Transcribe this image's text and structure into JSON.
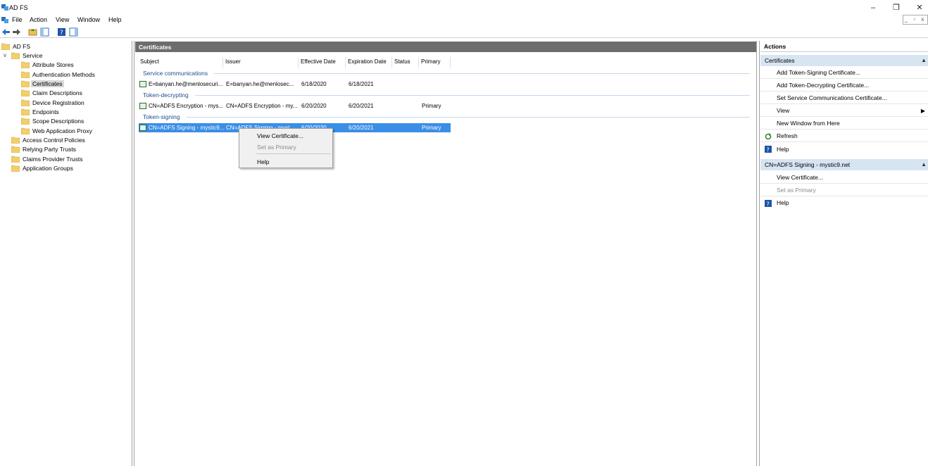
{
  "window": {
    "title": "AD FS",
    "minimize": "–",
    "restore": "❐",
    "close": "✕"
  },
  "menu": [
    "File",
    "Action",
    "View",
    "Window",
    "Help"
  ],
  "mdi_controls": "_ ▫ x",
  "tree": {
    "root": "AD FS",
    "service": "Service",
    "service_children": [
      "Attribute Stores",
      "Authentication Methods",
      "Certificates",
      "Claim Descriptions",
      "Device Registration",
      "Endpoints",
      "Scope Descriptions",
      "Web Application Proxy"
    ],
    "top_level": [
      "Access Control Policies",
      "Relying Party Trusts",
      "Claims Provider Trusts",
      "Application Groups"
    ]
  },
  "center": {
    "title": "Certificates",
    "columns": [
      "Subject",
      "Issuer",
      "Effective Date",
      "Expiration Date",
      "Status",
      "Primary"
    ],
    "groups": [
      {
        "name": "Service communications",
        "rows": [
          {
            "subject": "E=banyan.he@menlosecuri...",
            "issuer": "E=banyan.he@menlosec...",
            "effective": "6/18/2020",
            "expiration": "6/18/2021",
            "status": "",
            "primary": ""
          }
        ]
      },
      {
        "name": "Token-decrypting",
        "rows": [
          {
            "subject": "CN=ADFS Encryption - mys...",
            "issuer": "CN=ADFS Encryption - my...",
            "effective": "6/20/2020",
            "expiration": "6/20/2021",
            "status": "",
            "primary": "Primary"
          }
        ]
      },
      {
        "name": "Token-signing",
        "rows": [
          {
            "subject": "CN=ADFS Signing - mystic9...",
            "issuer": "CN=ADFS Signing - myst...",
            "effective": "6/20/2020",
            "expiration": "6/20/2021",
            "status": "",
            "primary": "Primary"
          }
        ]
      }
    ]
  },
  "context_menu": {
    "view": "View Certificate...",
    "set_primary": "Set as Primary",
    "help": "Help"
  },
  "actions": {
    "title": "Actions",
    "section1": "Certificates",
    "section1_items": [
      "Add Token-Signing Certificate...",
      "Add Token-Decrypting Certificate...",
      "Set Service Communications Certificate...",
      "View",
      "New Window from Here",
      "Refresh",
      "Help"
    ],
    "section2": "CN=ADFS Signing - mystic9.net",
    "section2_items": [
      "View Certificate...",
      "Set as Primary",
      "Help"
    ]
  }
}
